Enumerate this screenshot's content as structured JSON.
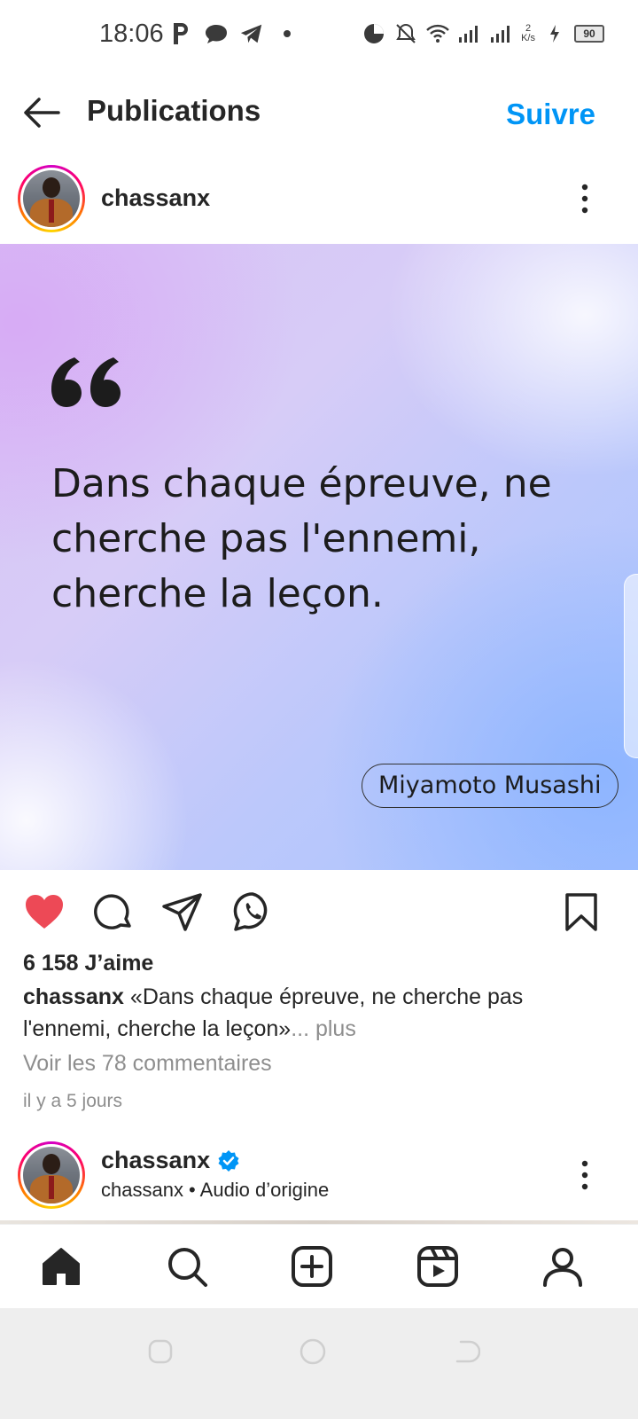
{
  "status_bar": {
    "time": "18:06",
    "left_icons": [
      "parking-app-icon",
      "chat-bubble-icon",
      "telegram-icon",
      "dot-icon"
    ],
    "right_icons": [
      "data-saver-icon",
      "bell-off-icon",
      "wifi-icon",
      "signal-icon",
      "signal-icon",
      "speed-indicator",
      "charging-icon",
      "battery-icon"
    ],
    "speed_value": "2",
    "speed_unit": "K/s",
    "battery_level": "90"
  },
  "header": {
    "title": "Publications",
    "follow_label": "Suivre"
  },
  "post": {
    "username": "chassanx",
    "quote": "Dans chaque épreuve, ne cherche pas l'ennemi, cherche la leçon.",
    "author": "Miyamoto Musashi",
    "likes": "6 158 J’aime",
    "caption_user": "chassanx",
    "caption_text": " «Dans chaque épreuve, ne cherche pas l'ennemi, cherche la leçon»",
    "caption_more": "... plus",
    "view_comments": "Voir les 78 commentaires",
    "timestamp": "il y a 5 jours",
    "liked": true,
    "accent_like": "#ed4956",
    "accent_link": "#0095f6"
  },
  "next_post": {
    "username": "chassanx",
    "verified": true,
    "subtitle": "chassanx • Audio d’origine"
  },
  "bottom_nav": [
    "home-icon",
    "search-icon",
    "create-icon",
    "reels-icon",
    "profile-icon"
  ],
  "system_nav": [
    "recents-button",
    "home-button",
    "back-button"
  ]
}
